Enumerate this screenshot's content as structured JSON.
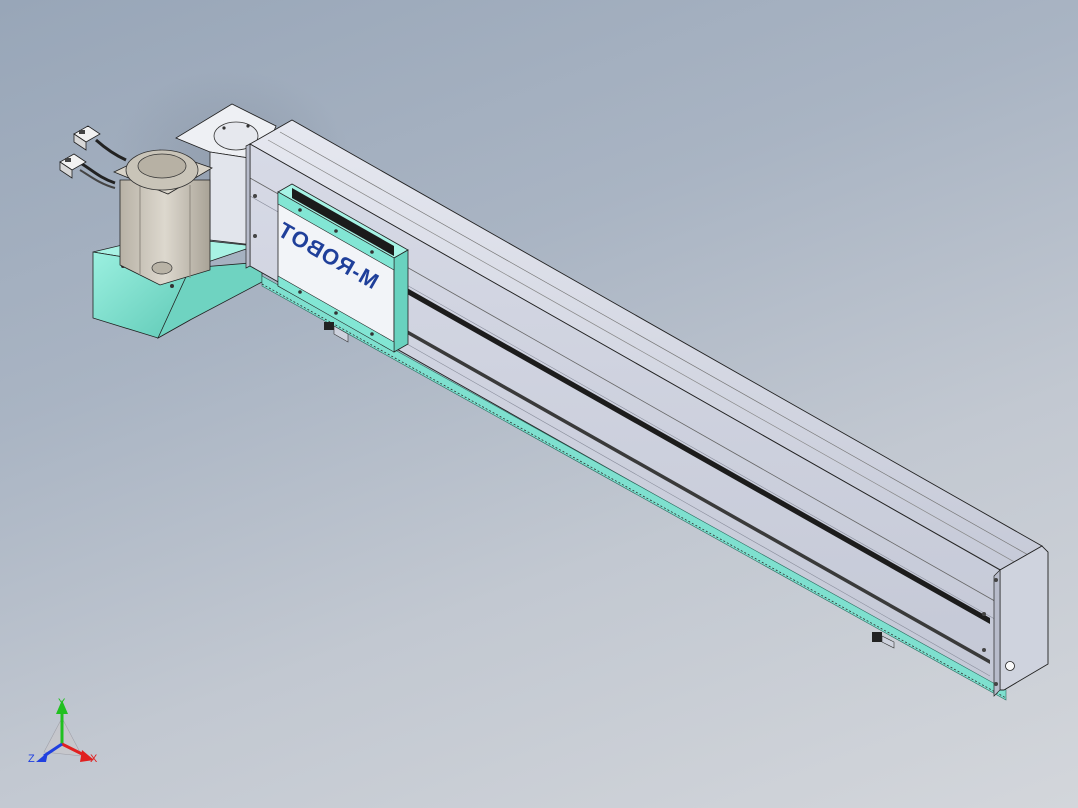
{
  "scene": {
    "brand_logo_text": "M-ROBOT"
  },
  "triad": {
    "x_label": "X",
    "y_label": "Y",
    "z_label": "Z"
  },
  "colors": {
    "background_top": "#98a6b8",
    "background_bottom": "#d3d6db",
    "aluminum": "#d4d7e3",
    "aluminum_dark": "#a8adbd",
    "teal": "#7ee0cf",
    "motor": "#cfcac0",
    "logo_blue": "#1f3f9a",
    "axis_x": "#e02020",
    "axis_y": "#20c020",
    "axis_z": "#2040e0"
  },
  "icons": {
    "triad": "coordinate-triad-icon"
  }
}
